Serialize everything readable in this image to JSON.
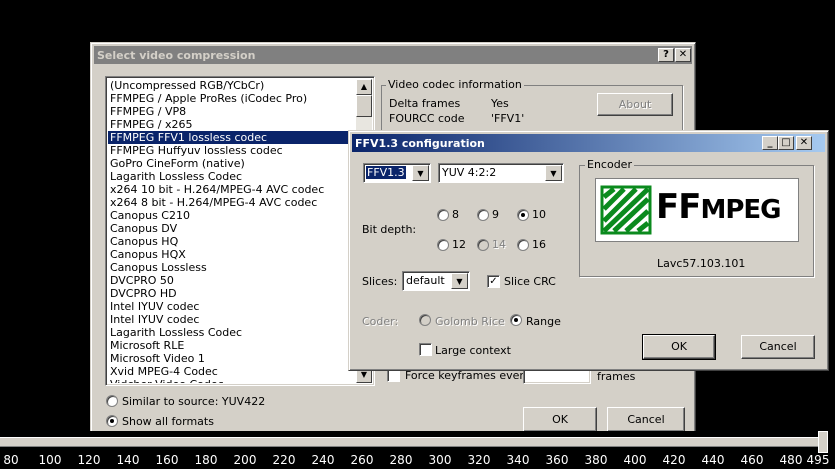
{
  "main_dialog": {
    "title": "Select video compression",
    "help_btn": "?",
    "close_btn": "✕",
    "codecs": [
      "(Uncompressed RGB/YCbCr)",
      "FFMPEG / Apple ProRes (iCodec Pro)",
      "FFMPEG / VP8",
      "FFMPEG / x265",
      "FFMPEG FFV1 lossless codec",
      "FFMPEG Huffyuv lossless codec",
      "GoPro CineForm (native)",
      "Lagarith Lossless Codec",
      "x264 10 bit - H.264/MPEG-4 AVC codec",
      "x264 8 bit - H.264/MPEG-4 AVC codec",
      "Canopus C210",
      "Canopus DV",
      "Canopus HQ",
      "Canopus HQX",
      "Canopus Lossless",
      "DVCPRO 50",
      "DVCPRO HD",
      "Intel IYUV codec",
      "Intel IYUV codec",
      "Lagarith Lossless Codec",
      "Microsoft RLE",
      "Microsoft Video 1",
      "Xvid MPEG-4 Codec",
      "Vidcher Video Codec"
    ],
    "selected_index": 4,
    "codec_info": {
      "group_title": "Video codec information",
      "delta_label": "Delta frames",
      "delta_value": "Yes",
      "fourcc_label": "FOURCC code",
      "fourcc_value": "'FFV1'",
      "about_btn": "About"
    },
    "force_keyframes": "Force keyframes every",
    "frames": "frames",
    "similar_source": "Similar to source: YUV422",
    "show_all": "Show all formats",
    "ok": "OK",
    "cancel": "Cancel"
  },
  "ffv_dialog": {
    "title": "FFV1.3 configuration",
    "version": "FFV1.3",
    "format": "YUV 4:2:2",
    "bit_depth_label": "Bit depth:",
    "depths": [
      "8",
      "9",
      "10",
      "12",
      "14",
      "16"
    ],
    "selected_depth": "10",
    "slices_label": "Slices:",
    "slices_value": "default",
    "slice_crc": "Slice CRC",
    "coder_label": "Coder:",
    "golomb": "Golomb Rice",
    "range": "Range",
    "large_context": "Large context",
    "encoder_group": "Encoder",
    "logo_text": "FFmpeg",
    "lavc": "Lavc57.103.101",
    "ok": "OK",
    "cancel": "Cancel"
  },
  "ruler": {
    "ticks": [
      "80",
      "100",
      "120",
      "140",
      "160",
      "180",
      "200",
      "220",
      "240",
      "260",
      "280",
      "300",
      "320",
      "340",
      "360",
      "380",
      "400",
      "420",
      "440",
      "460",
      "480",
      "495"
    ]
  }
}
